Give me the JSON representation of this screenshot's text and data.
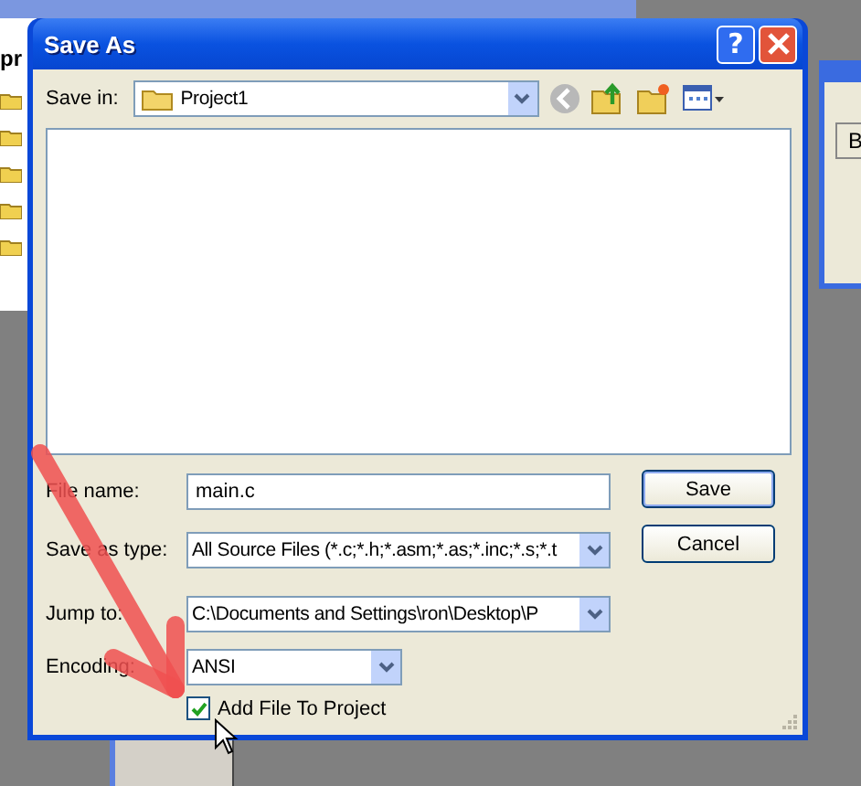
{
  "background": {
    "left_window_text": "pr",
    "right_window_text": "B"
  },
  "dialog": {
    "title": "Save As",
    "help_glyph": "?",
    "save_in": {
      "label": "Save in:",
      "value": "Project1"
    },
    "fields": [
      {
        "kind": "text",
        "label": "File name:",
        "value": "main.c"
      },
      {
        "kind": "combo",
        "label": "Save as type:",
        "value": "All Source Files (*.c;*.h;*.asm;*.as;*.inc;*.s;*.t"
      },
      {
        "kind": "combo",
        "label": "Jump to:",
        "value": "C:\\Documents and Settings\\ron\\Desktop\\P"
      },
      {
        "kind": "short_combo",
        "label": "Encoding:",
        "value": "ANSI"
      }
    ],
    "buttons": [
      "Save",
      "Cancel"
    ],
    "add_to_project": {
      "label": "Add File To Project",
      "checked": true
    }
  }
}
